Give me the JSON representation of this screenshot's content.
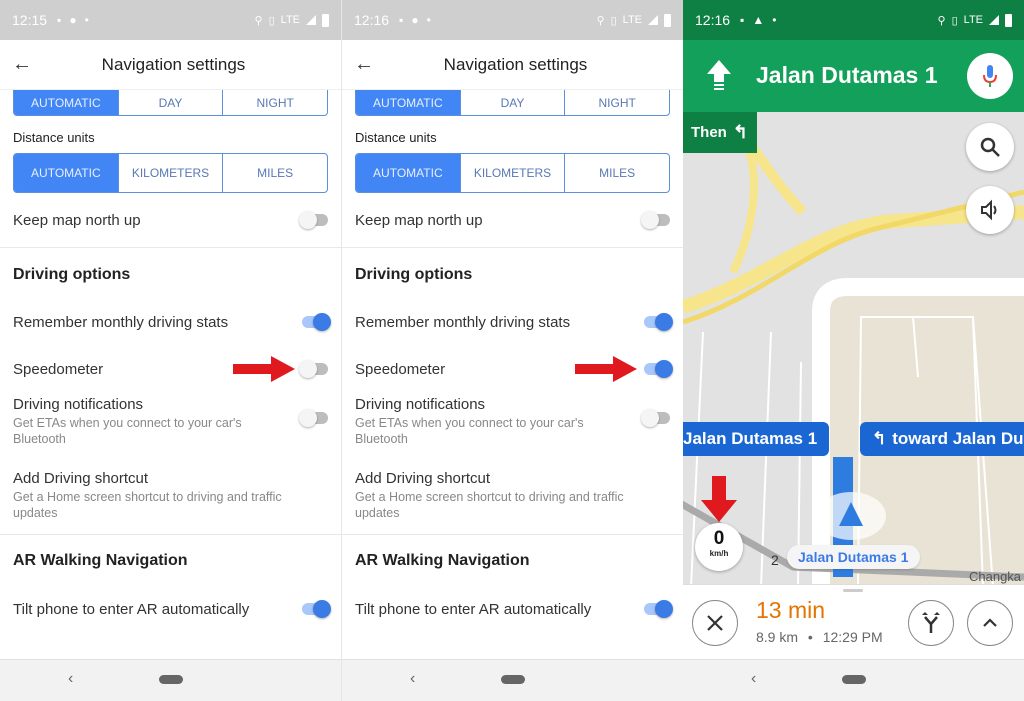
{
  "colors": {
    "accent": "#4285f4",
    "nav_green": "#13a05a",
    "nav_dark_green": "#0e8043",
    "callout_blue": "#1a66d2",
    "eta_orange": "#e37400",
    "annotation_red": "#e0191f"
  },
  "settings_panels": [
    {
      "status": {
        "time": "12:15",
        "network": "LTE"
      },
      "title": "Navigation settings",
      "map_display": {
        "options": [
          "AUTOMATIC",
          "DAY",
          "NIGHT"
        ],
        "selected": "AUTOMATIC"
      },
      "distance_units": {
        "label": "Distance units",
        "options": [
          "AUTOMATIC",
          "KILOMETERS",
          "MILES"
        ],
        "selected": "AUTOMATIC"
      },
      "keep_north_up": {
        "label": "Keep map north up",
        "on": false
      },
      "driving_options": {
        "title": "Driving options",
        "monthly_stats": {
          "label": "Remember monthly driving stats",
          "on": true
        },
        "speedometer": {
          "label": "Speedometer",
          "on": false
        },
        "notifications": {
          "label": "Driving notifications",
          "sub": "Get ETAs when you connect to your car's Bluetooth",
          "on": false
        },
        "shortcut": {
          "label": "Add Driving shortcut",
          "sub": "Get a Home screen shortcut to driving and traffic updates"
        }
      },
      "ar": {
        "title": "AR Walking Navigation",
        "tilt": {
          "label": "Tilt phone to enter AR automatically",
          "on": true
        }
      }
    },
    {
      "status": {
        "time": "12:16",
        "network": "LTE"
      },
      "title": "Navigation settings",
      "map_display": {
        "options": [
          "AUTOMATIC",
          "DAY",
          "NIGHT"
        ],
        "selected": "AUTOMATIC"
      },
      "distance_units": {
        "label": "Distance units",
        "options": [
          "AUTOMATIC",
          "KILOMETERS",
          "MILES"
        ],
        "selected": "AUTOMATIC"
      },
      "keep_north_up": {
        "label": "Keep map north up",
        "on": false
      },
      "driving_options": {
        "title": "Driving options",
        "monthly_stats": {
          "label": "Remember monthly driving stats",
          "on": true
        },
        "speedometer": {
          "label": "Speedometer",
          "on": true
        },
        "notifications": {
          "label": "Driving notifications",
          "sub": "Get ETAs when you connect to your car's Bluetooth",
          "on": false
        },
        "shortcut": {
          "label": "Add Driving shortcut",
          "sub": "Get a Home screen shortcut to driving and traffic updates"
        }
      },
      "ar": {
        "title": "AR Walking Navigation",
        "tilt": {
          "label": "Tilt phone to enter AR automatically",
          "on": true
        }
      }
    }
  ],
  "navigation": {
    "status": {
      "time": "12:16",
      "network": "LTE"
    },
    "current_street": "Jalan Dutamas 1",
    "then_label": "Then",
    "callout_left": "Jalan Dutamas 1",
    "callout_right": "toward Jalan Du",
    "road_label": "Jalan Dutamas 1",
    "road_label_prefix": "2",
    "area_label": "Changka",
    "speed": {
      "value": "0",
      "unit": "km/h"
    },
    "eta": {
      "duration": "13 min",
      "distance": "8.9 km",
      "separator": "•",
      "arrival": "12:29 PM"
    }
  },
  "icons": {
    "back": "arrow-left-icon",
    "search": "search-icon",
    "volume": "volume-icon",
    "mic": "mic-icon",
    "close": "close-icon",
    "alternate_routes": "fork-icon",
    "expand": "chevron-up-icon"
  },
  "nav_bar": {
    "back": "‹"
  }
}
